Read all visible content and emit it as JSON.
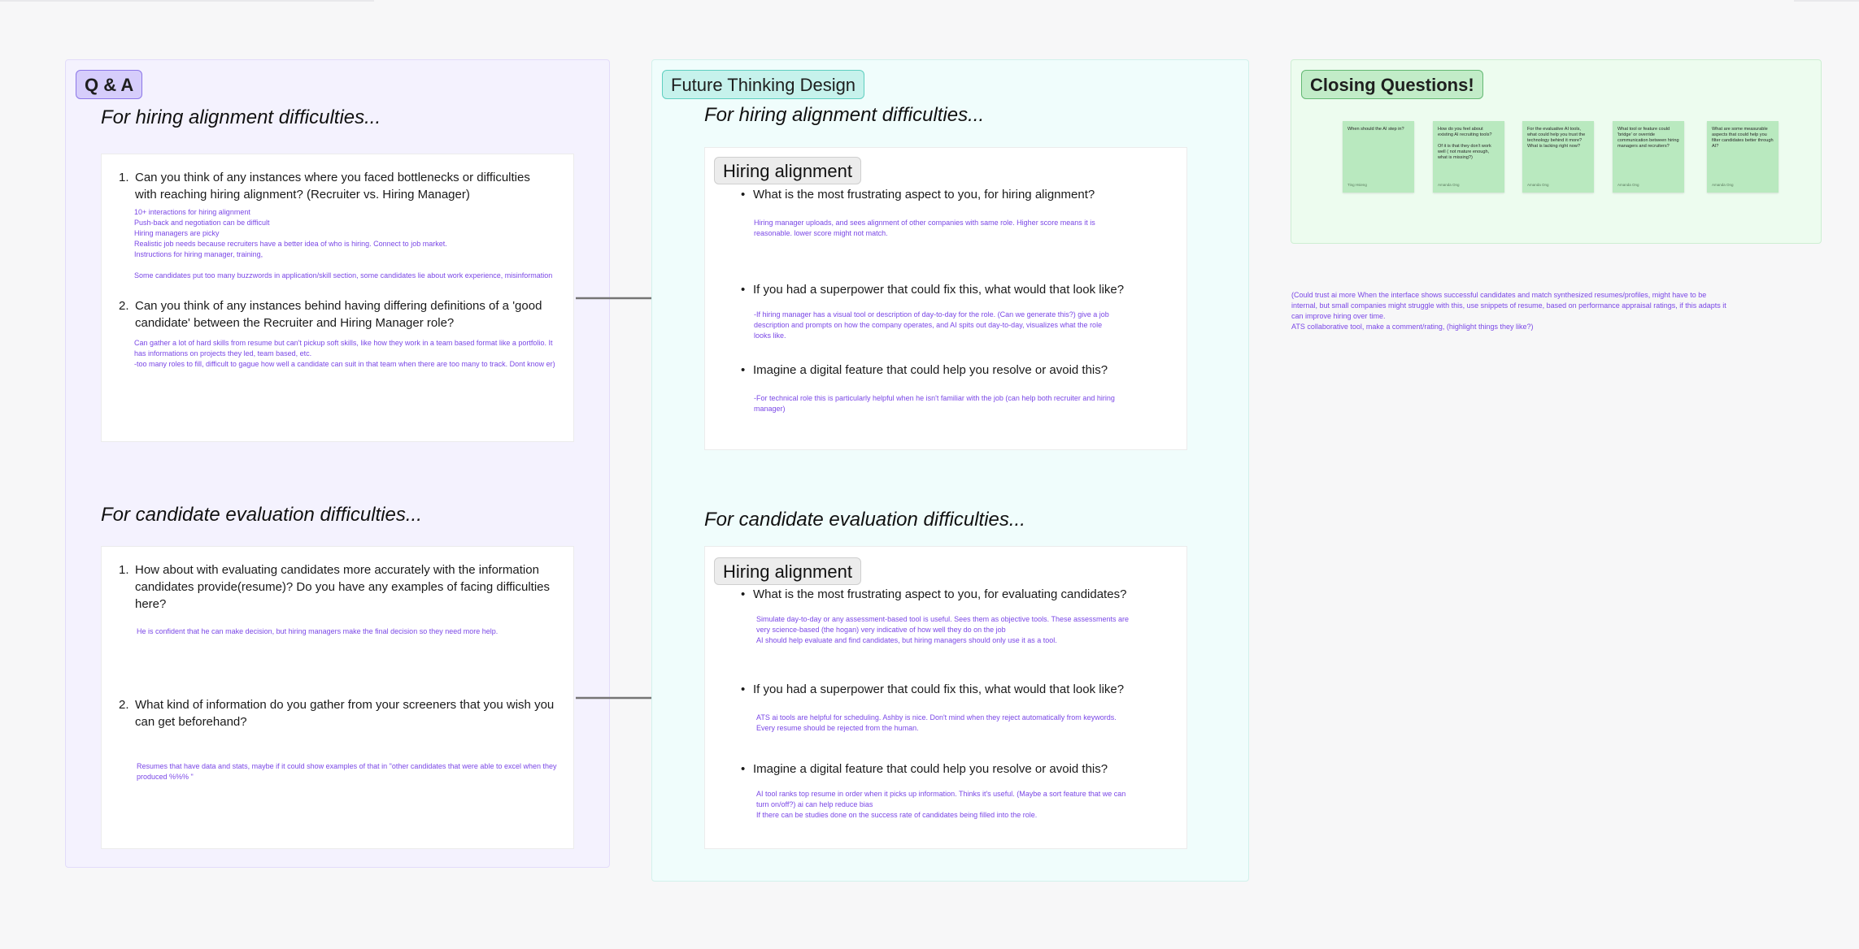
{
  "qa": {
    "label": "Q & A",
    "hiring_heading": "For hiring alignment difficulties...",
    "candidate_heading": "For candidate evaluation difficulties...",
    "hiring_questions": [
      {
        "num": "1.",
        "text": "Can you think of any instances where you faced bottlenecks or difficulties with reaching hiring alignment?  (Recruiter vs. Hiring Manager)",
        "notes": [
          " 10+ interactions for hiring alignment",
          "Push-back and negotiation can be difficult",
          "Hiring managers are picky",
          "Realistic job needs because recruiters have a better idea of who is hiring. Connect to job market.",
          "Instructions for hiring manager, training,",
          "",
          "Some candidates put too many buzzwords in application/skill section, some candidates lie about work experience, misinformation"
        ]
      },
      {
        "num": "2.",
        "text": "Can you think of any instances behind having differing definitions of a 'good candidate' between the Recruiter and Hiring Manager role?",
        "notes": [
          "Can gather a lot of hard skills from resume but can't pickup soft skills, like how they work in a team based format like a portfolio. It has informations on projects they led, team based, etc.",
          "-too many roles to fill, difficult to gague how well a candidate can suit in that team when there are too many to track. Dont know er)"
        ]
      }
    ],
    "candidate_questions": [
      {
        "num": "1.",
        "text": "How about with evaluating candidates more accurately with the information candidates provide(resume)? Do you have any examples of facing difficulties here?",
        "notes": [
          "He is confident that he can make decision, but hiring managers make the final decision so they need more help."
        ]
      },
      {
        "num": "2.",
        "text": "What kind of information do you gather from your screeners that you wish you can get beforehand?",
        "notes": [
          "Resumes that have data and stats, maybe if it could show examples of that in \"other candidates that were able to excel when they produced %%% \""
        ]
      }
    ]
  },
  "ftd": {
    "label": "Future Thinking Design",
    "hiring_heading": "For hiring alignment difficulties...",
    "candidate_heading": "For candidate evaluation difficulties...",
    "hiring_card": {
      "label": "Hiring alignment",
      "items": [
        {
          "text": "What is the most frustrating aspect to you, for hiring alignment?",
          "notes": [
            "Hiring manager uploads, and sees alignment of other companies with same role. Higher score means it is reasonable. lower score might not match."
          ]
        },
        {
          "text": "If you had a superpower that could fix this, what would that look like?",
          "notes": [
            "-If hiring manager has a visual tool or description of day-to-day for the role. (Can we generate this?) give a job description and prompts on how the company operates, and AI spits out day-to-day, visualizes what the role looks like."
          ]
        },
        {
          "text": "Imagine a digital feature that could help you resolve or avoid this?",
          "notes": [
            "-For technical role this is particularly helpful when he isn't familiar with the job (can help both recruiter and hiring manager)"
          ]
        }
      ]
    },
    "candidate_card": {
      "label": "Hiring alignment",
      "items": [
        {
          "text": "What is the most frustrating aspect to you, for evaluating candidates?",
          "notes": [
            "Simulate day-to-day or any assessment-based tool is useful. Sees them as objective tools. These assessments are very science-based (the hogan) very indicative of how well they do on the job",
            "AI should help evaluate and find candidates, but hiring managers should only use it as a tool."
          ]
        },
        {
          "text": "If you had a superpower that could fix this, what would that look like?",
          "notes": [
            "ATS ai tools are helpful for scheduling. Ashby is nice. Don't mind when they reject automatically from keywords.",
            "Every resume should be rejected from the human."
          ]
        },
        {
          "text": "Imagine a digital feature that could help you resolve or avoid this?",
          "notes": [
            "AI tool ranks top resume in order when it picks up information. Thinks it's useful. (Maybe a sort feature that we can turn on/off?) ai can help reduce bias",
            "If there can be studies done on the success rate of candidates being filled into the role."
          ]
        }
      ]
    }
  },
  "cq": {
    "label": "Closing Questions!",
    "stickies": [
      {
        "text": "When should the AI step in?",
        "author": "Ting Hsieng"
      },
      {
        "text": "How do you feel about existing AI recruiting tools?\n\nOf it is that they don't work well ( not mature enough, what is missing?)",
        "author": "Amanda Ong"
      },
      {
        "text": "For the evaluative AI tools, what could help you trust the technology behind it more? What is lacking right now?",
        "author": "Amanda Ong"
      },
      {
        "text": "What tool or feature could 'bridge' or override communication between hiring managers and recruiters?",
        "author": "Amanda Ong"
      },
      {
        "text": "What are some measurable aspects that could help you filter candidates better through AI?",
        "author": "Amanda Ong"
      }
    ],
    "side_notes": [
      "(Could trust ai more When the interface shows successful candidates and match synthesized resumes/profiles, might have to be internal, but small companies might struggle with this, use snippets of resume, based on performance appraisal ratings, if this adapts it can improve hiring over time.",
      "ATS collaborative tool, make a comment/rating, (highlight things they like?)"
    ]
  },
  "colors": {
    "qa_bg": "#f4f2fe",
    "ftd_bg": "#f0fdfc",
    "cq_bg": "#edfcef",
    "note_text": "#7a47e6",
    "sticky": "#b9e9bf",
    "arrow": "#757575"
  }
}
